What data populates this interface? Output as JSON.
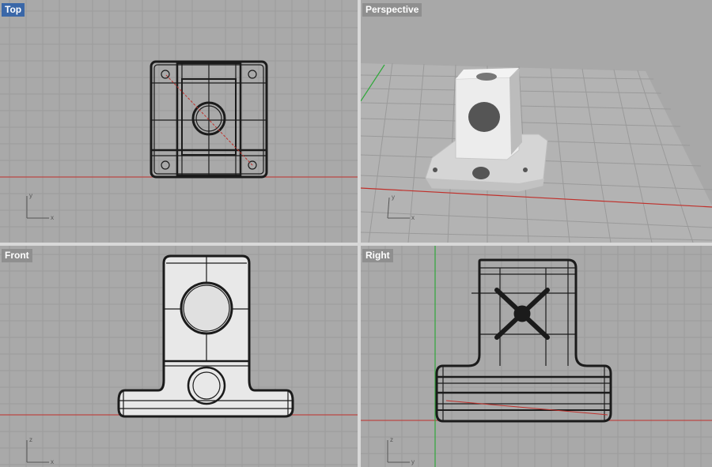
{
  "viewports": {
    "top": {
      "title": "Top",
      "active": true
    },
    "perspective": {
      "title": "Perspective",
      "active": false
    },
    "front": {
      "title": "Front",
      "active": false
    },
    "right": {
      "title": "Right",
      "active": false
    }
  },
  "axis_labels": {
    "top": {
      "v": "y",
      "h": "x"
    },
    "perspective": {
      "v": "y",
      "h": "x"
    },
    "front": {
      "v": "z",
      "h": "x"
    },
    "right": {
      "v": "z",
      "h": "y"
    }
  },
  "colors": {
    "viewport_bg": "#a9a9a9",
    "grid_line": "#9c9c9c",
    "grid_major": "#8e8e8e",
    "x_axis": "#c0302b",
    "y_axis": "#2fa83a",
    "active_label": "#3a67a8",
    "wire": "#1b1b1b",
    "shaded": "#e8e8e8"
  }
}
